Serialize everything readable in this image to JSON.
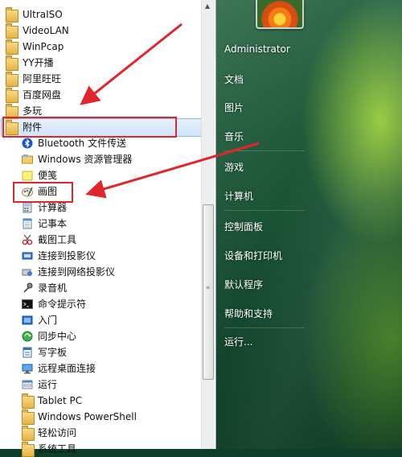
{
  "start_menu": {
    "programs": [
      {
        "label": "UltraISO",
        "icon": "folder-icon",
        "indent": 0
      },
      {
        "label": "VideoLAN",
        "icon": "folder-icon",
        "indent": 0
      },
      {
        "label": "WinPcap",
        "icon": "folder-icon",
        "indent": 0
      },
      {
        "label": "YY开播",
        "icon": "folder-icon",
        "indent": 0
      },
      {
        "label": "阿里旺旺",
        "icon": "folder-icon",
        "indent": 0
      },
      {
        "label": "百度网盘",
        "icon": "folder-icon",
        "indent": 0
      },
      {
        "label": "多玩",
        "icon": "folder-icon",
        "indent": 0
      },
      {
        "label": "附件",
        "icon": "folder-icon",
        "indent": 0,
        "selected": true
      },
      {
        "label": "Bluetooth 文件传送",
        "icon": "bluetooth-icon",
        "indent": 1
      },
      {
        "label": "Windows 资源管理器",
        "icon": "explorer-icon",
        "indent": 1
      },
      {
        "label": "便笺",
        "icon": "sticky-notes-icon",
        "indent": 1
      },
      {
        "label": "画图",
        "icon": "paint-icon",
        "indent": 1
      },
      {
        "label": "计算器",
        "icon": "calculator-icon",
        "indent": 1
      },
      {
        "label": "记事本",
        "icon": "notepad-icon",
        "indent": 1
      },
      {
        "label": "截图工具",
        "icon": "snipping-tool-icon",
        "indent": 1
      },
      {
        "label": "连接到投影仪",
        "icon": "projector-icon",
        "indent": 1
      },
      {
        "label": "连接到网络投影仪",
        "icon": "network-projector-icon",
        "indent": 1
      },
      {
        "label": "录音机",
        "icon": "sound-recorder-icon",
        "indent": 1
      },
      {
        "label": "命令提示符",
        "icon": "command-prompt-icon",
        "indent": 1
      },
      {
        "label": "入门",
        "icon": "getting-started-icon",
        "indent": 1
      },
      {
        "label": "同步中心",
        "icon": "sync-center-icon",
        "indent": 1
      },
      {
        "label": "写字板",
        "icon": "wordpad-icon",
        "indent": 1
      },
      {
        "label": "远程桌面连接",
        "icon": "remote-desktop-icon",
        "indent": 1
      },
      {
        "label": "运行",
        "icon": "run-icon",
        "indent": 1
      },
      {
        "label": "Tablet PC",
        "icon": "folder-icon",
        "indent": 1
      },
      {
        "label": "Windows PowerShell",
        "icon": "folder-icon",
        "indent": 1
      },
      {
        "label": "轻松访问",
        "icon": "folder-icon",
        "indent": 1
      },
      {
        "label": "系统工具",
        "icon": "folder-icon",
        "indent": 1
      }
    ],
    "right_items": [
      {
        "label": "Administrator"
      },
      {
        "label": "文档"
      },
      {
        "label": "图片"
      },
      {
        "label": "音乐"
      },
      {
        "label": "游戏"
      },
      {
        "label": "计算机"
      },
      {
        "label": "控制面板"
      },
      {
        "label": "设备和打印机"
      },
      {
        "label": "默认程序"
      },
      {
        "label": "帮助和支持"
      },
      {
        "label": "运行..."
      }
    ]
  },
  "colors": {
    "annotation": "#e0262a",
    "selection": "#cfe3fa"
  }
}
